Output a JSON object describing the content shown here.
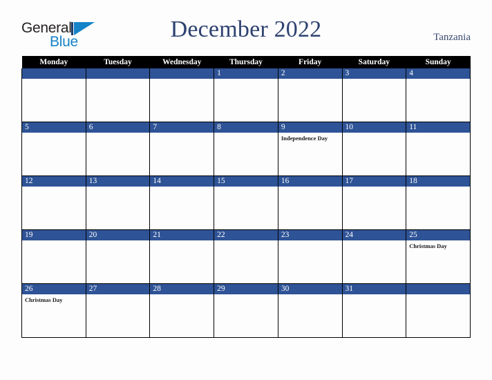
{
  "brand": {
    "name_part1": "General",
    "name_part2": "Blue",
    "triangle_icon": "triangle-icon",
    "color_dark": "#231f20",
    "color_blue": "#1583c8"
  },
  "header": {
    "title": "December 2022",
    "country": "Tanzania",
    "title_color": "#2e4270"
  },
  "calendar": {
    "accent_color": "#2e5396",
    "header_bg": "#000000",
    "weekday_headers": [
      "Monday",
      "Tuesday",
      "Wednesday",
      "Thursday",
      "Friday",
      "Saturday",
      "Sunday"
    ],
    "weeks": [
      [
        {
          "day": "",
          "events": []
        },
        {
          "day": "",
          "events": []
        },
        {
          "day": "",
          "events": []
        },
        {
          "day": "1",
          "events": []
        },
        {
          "day": "2",
          "events": []
        },
        {
          "day": "3",
          "events": []
        },
        {
          "day": "4",
          "events": []
        }
      ],
      [
        {
          "day": "5",
          "events": []
        },
        {
          "day": "6",
          "events": []
        },
        {
          "day": "7",
          "events": []
        },
        {
          "day": "8",
          "events": []
        },
        {
          "day": "9",
          "events": [
            "Independence Day"
          ]
        },
        {
          "day": "10",
          "events": []
        },
        {
          "day": "11",
          "events": []
        }
      ],
      [
        {
          "day": "12",
          "events": []
        },
        {
          "day": "13",
          "events": []
        },
        {
          "day": "14",
          "events": []
        },
        {
          "day": "15",
          "events": []
        },
        {
          "day": "16",
          "events": []
        },
        {
          "day": "17",
          "events": []
        },
        {
          "day": "18",
          "events": []
        }
      ],
      [
        {
          "day": "19",
          "events": []
        },
        {
          "day": "20",
          "events": []
        },
        {
          "day": "21",
          "events": []
        },
        {
          "day": "22",
          "events": []
        },
        {
          "day": "23",
          "events": []
        },
        {
          "day": "24",
          "events": []
        },
        {
          "day": "25",
          "events": [
            "Christmas Day"
          ]
        }
      ],
      [
        {
          "day": "26",
          "events": [
            "Christmas Day"
          ]
        },
        {
          "day": "27",
          "events": []
        },
        {
          "day": "28",
          "events": []
        },
        {
          "day": "29",
          "events": []
        },
        {
          "day": "30",
          "events": []
        },
        {
          "day": "31",
          "events": []
        },
        {
          "day": "",
          "events": []
        }
      ]
    ]
  }
}
